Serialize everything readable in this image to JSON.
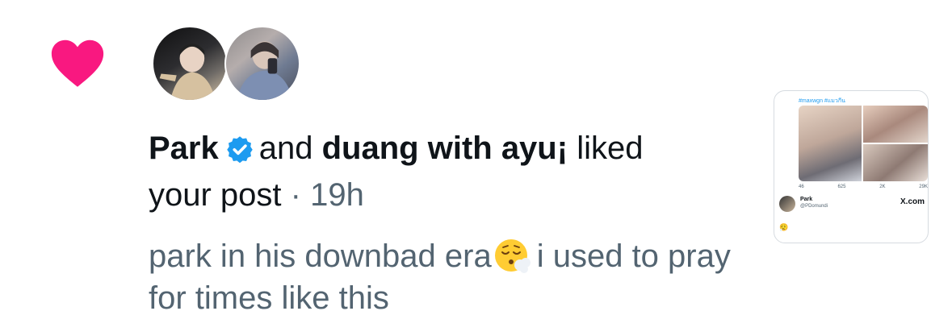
{
  "notification": {
    "type": "like",
    "icon": "heart-icon",
    "accent_color": "#f91880",
    "users": [
      {
        "name": "Park",
        "verified": true
      },
      {
        "name": "duang with ayu¡",
        "verified": false
      }
    ],
    "connector": "and",
    "action_text": "liked",
    "object_text": "your post",
    "separator": "·",
    "time": "19h",
    "post_text_1": "park in his downbad era",
    "post_emoji": "face-exhaling-emoji",
    "post_text_2": "i used to pray for times like this"
  },
  "thumbnail": {
    "hashtags_top": "#maxwgn #แมวกีน",
    "stats": [
      "46",
      "625",
      "2K",
      "29K"
    ],
    "author_name": "Park",
    "author_handle": "@PDomundi",
    "site": "X.com",
    "verified_color": "#1d9bf0"
  }
}
